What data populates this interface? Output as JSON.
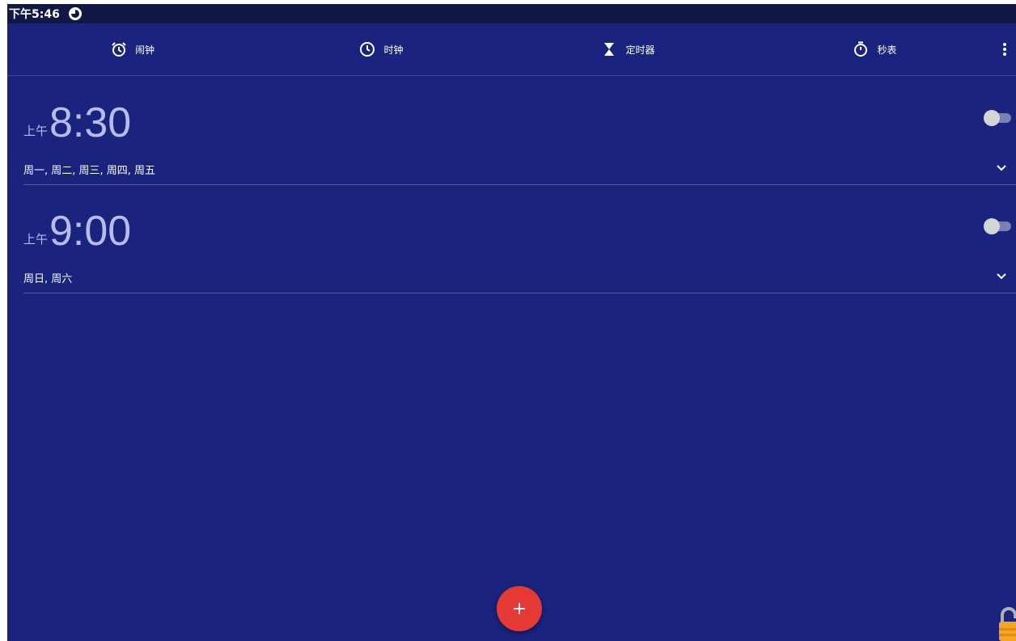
{
  "status_bar": {
    "time": "下午5:46",
    "icon": "notification-icon"
  },
  "tabs": [
    {
      "label": "闹钟",
      "icon": "alarm-icon"
    },
    {
      "label": "时钟",
      "icon": "clock-icon"
    },
    {
      "label": "定时器",
      "icon": "hourglass-icon"
    },
    {
      "label": "秒表",
      "icon": "stopwatch-icon"
    }
  ],
  "alarms": [
    {
      "ampm": "上午",
      "time": "8:30",
      "days": "周一, 周二, 周三, 周四, 周五",
      "enabled": false
    },
    {
      "ampm": "上午",
      "time": "9:00",
      "days": "周日, 周六",
      "enabled": false
    }
  ],
  "fab": {
    "label": "+"
  },
  "colors": {
    "background": "#1a237e",
    "status_bar": "#111846",
    "fab": "#e53935",
    "time_text": "#b7bde8"
  }
}
